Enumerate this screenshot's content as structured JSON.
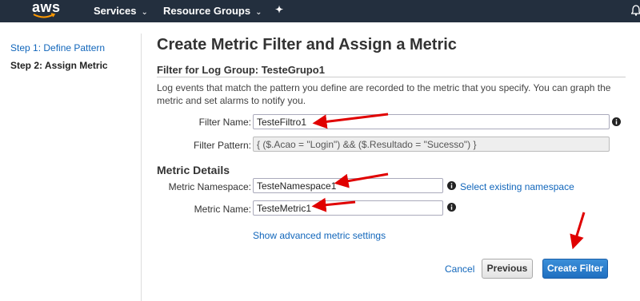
{
  "topnav": {
    "logo_text": "aws",
    "services_label": "Services",
    "resource_groups_label": "Resource Groups",
    "chevron": "⌄",
    "pin_glyph": "✦"
  },
  "sidebar": {
    "steps": [
      {
        "label": "Step 1: Define Pattern",
        "state": "link"
      },
      {
        "label": "Step 2: Assign Metric",
        "state": "current"
      }
    ]
  },
  "main": {
    "title": "Create Metric Filter and Assign a Metric",
    "log_group_title": "Filter for Log Group: TesteGrupo1",
    "description": "Log events that match the pattern you define are recorded to the metric that you specify. You can graph the metric and set alarms to notify you.",
    "filter_name": {
      "label": "Filter Name:",
      "value": "TesteFiltro1"
    },
    "filter_pattern": {
      "label": "Filter Pattern:",
      "value": "{ ($.Acao = \"Login\") && ($.Resultado = \"Sucesso\") }"
    },
    "metric_details_title": "Metric Details",
    "metric_namespace": {
      "label": "Metric Namespace:",
      "value": "TesteNamespace1"
    },
    "select_namespace_link": "Select existing namespace",
    "metric_name": {
      "label": "Metric Name:",
      "value": "TesteMetric1"
    },
    "advanced_link": "Show advanced metric settings",
    "cancel_label": "Cancel",
    "previous_label": "Previous",
    "create_label": "Create Filter"
  },
  "colors": {
    "nav_bg": "#232f3e",
    "link": "#1166bb",
    "primary_button": "#1f6fc0",
    "annotation_arrow": "#e00000"
  }
}
